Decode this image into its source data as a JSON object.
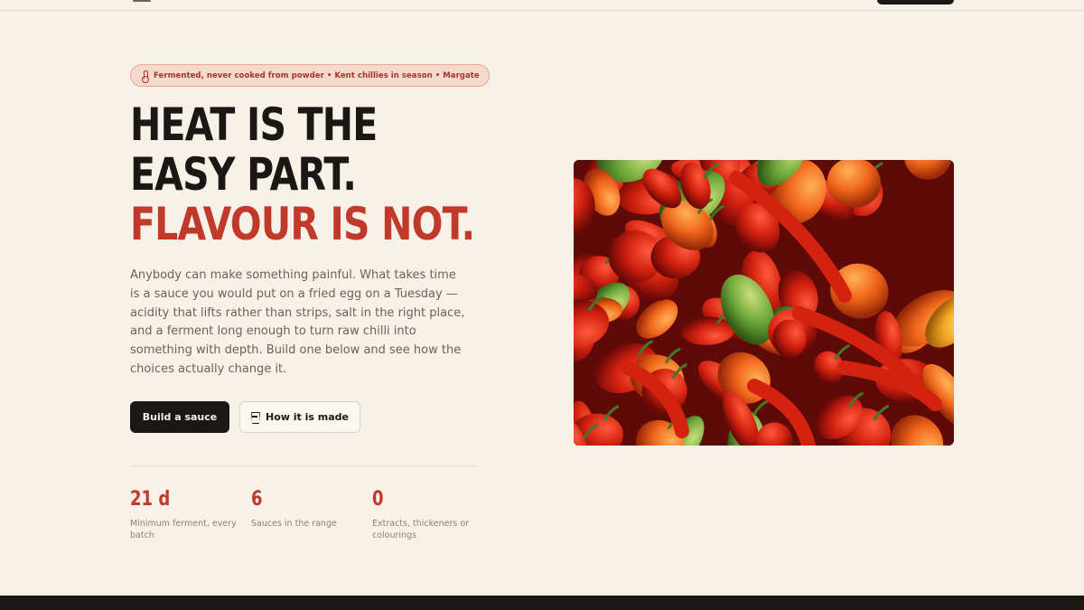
{
  "nav": {
    "menu_icon": "menu-icon",
    "cta_label": ""
  },
  "hero": {
    "badge": {
      "icon": "thermometer-icon",
      "text": "Fermented, never cooked from powder • Kent chillies in season • Margate"
    },
    "headline": {
      "line1": "HEAT IS THE",
      "line2": "EASY PART.",
      "line3": "FLAVOUR IS NOT."
    },
    "lede": "Anybody can make something painful. What takes time is a sauce you would put on a fried egg on a Tuesday — acidity that lifts rather than strips, salt in the right place, and a ferment long enough to turn raw chilli into something with depth. Build one below and see how the choices actually change it.",
    "buttons": {
      "primary": "Build a sauce",
      "secondary": "How it is made",
      "secondary_icon": "glass-icon"
    },
    "stats": [
      {
        "value": "21 d",
        "label": "Minimum ferment, every batch"
      },
      {
        "value": "6",
        "label": "Sauces in the range"
      },
      {
        "value": "0",
        "label": "Extracts, thickeners or colourings"
      }
    ],
    "image": {
      "subject": "pile of red, orange and green chilli peppers"
    }
  },
  "colors": {
    "background": "#f7f1e8",
    "ink": "#1a1714",
    "accent_red": "#c0392b",
    "muted_text": "#6b625a",
    "badge_bg": "#f4d9cd"
  }
}
